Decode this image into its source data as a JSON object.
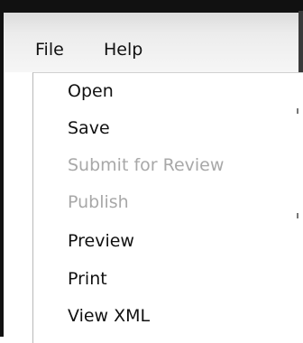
{
  "menubar": {
    "file_label": "File",
    "help_label": "Help"
  },
  "file_menu": {
    "items": [
      {
        "label": "Open",
        "enabled": true
      },
      {
        "label": "Save",
        "enabled": true
      },
      {
        "label": "Submit for Review",
        "enabled": false
      },
      {
        "label": "Publish",
        "enabled": false
      },
      {
        "label": "Preview",
        "enabled": true
      },
      {
        "label": "Print",
        "enabled": true
      },
      {
        "label": "View XML",
        "enabled": true
      }
    ]
  },
  "colors": {
    "enabled_text": "#111111",
    "disabled_text": "#a8a8a8",
    "window_border": "#111111"
  }
}
